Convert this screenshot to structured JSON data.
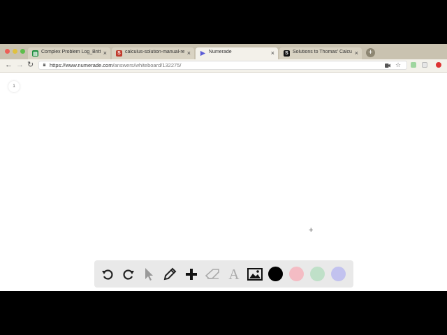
{
  "browser": {
    "tabs": [
      {
        "title": "Complex Problem Log_Brittany",
        "favicon": "sheets-icon",
        "favicon_color": "#1e8e3e",
        "active": false
      },
      {
        "title": "calculus-solution-manual-res",
        "favicon": "scribd-icon",
        "favicon_color": "#c0392b",
        "active": false
      },
      {
        "title": "Numerade",
        "favicon": "numerade-icon",
        "favicon_color": "#5b5bd6",
        "active": true
      },
      {
        "title": "Solutions to Thomas' Calculus",
        "favicon": "slader-icon",
        "favicon_color": "#111111",
        "active": false
      }
    ],
    "new_tab_label": "+",
    "address": {
      "host": "https://www.numerade.com",
      "path": "/answers/whiteboard/132275/"
    }
  },
  "whiteboard": {
    "page_number": "1",
    "tools": [
      "undo-icon",
      "redo-icon",
      "select-cursor-icon",
      "pencil-icon",
      "plus-icon",
      "eraser-icon",
      "text-icon",
      "image-icon"
    ],
    "colors": [
      "#000000",
      "#f4bcc4",
      "#bfe0c8",
      "#c2c2ef"
    ],
    "selected_color": "#000000"
  }
}
